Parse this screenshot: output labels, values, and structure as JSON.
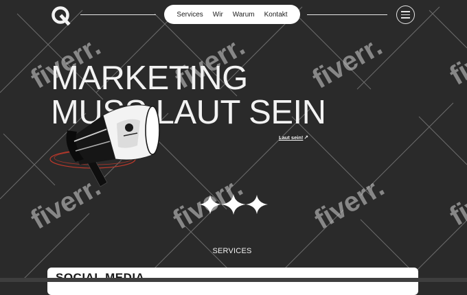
{
  "header": {
    "logo": "q-logo-icon",
    "nav": [
      "Services",
      "Wir",
      "Warum",
      "Kontakt"
    ],
    "menu": "hamburger-menu-icon"
  },
  "hero": {
    "line1": "MARKETING",
    "line2": "MUSS LAUT SEIN",
    "cta": "Laut sein!",
    "cta_icon": "arrow-up-right-icon",
    "image": "megaphone-icon"
  },
  "decoration": {
    "sparkles": "sparkle-icon"
  },
  "services": {
    "heading": "SERVICES",
    "card_title": "SOCIAL MEDIA"
  },
  "watermark": {
    "text": "fiverr."
  },
  "colors": {
    "background": "#2a2a2a",
    "text": "#f2f2f2",
    "pill": "#ffffff",
    "accent_red": "#c0392b"
  }
}
